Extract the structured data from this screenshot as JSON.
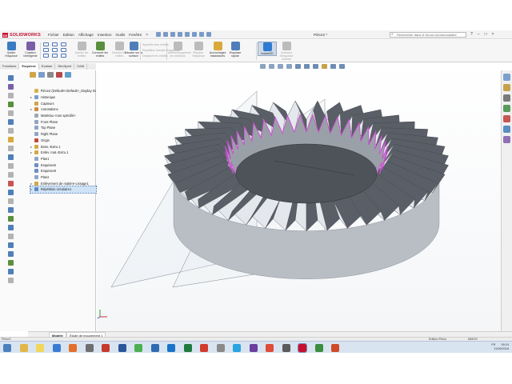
{
  "app": {
    "brand": "SOLIDWORKS",
    "document_title": "Pièce2 *",
    "menu": [
      "Fichier",
      "Edition",
      "Affichage",
      "Insertion",
      "Outils",
      "Fenêtre",
      "?"
    ],
    "search_placeholder": "Rechercher dans le forum communautaire",
    "window_controls": [
      "?",
      "–",
      "□",
      "×"
    ]
  },
  "command_manager": {
    "buttons": [
      {
        "id": "exit-sketch",
        "label": "Quitter l'esquisse",
        "color": "#3a7cc4",
        "enabled": true
      },
      {
        "id": "smart-dimension",
        "label": "Cotation intelligente",
        "color": "#7a5fa8",
        "enabled": true
      },
      {
        "id": "trim-entities",
        "label": "Ajuster les entités",
        "color": "#bcbcbc",
        "enabled": false
      },
      {
        "id": "convert-entities",
        "label": "Convertir les entités",
        "color": "#5a8f3c",
        "enabled": true
      },
      {
        "id": "offset-entities",
        "label": "Décaler les entités",
        "color": "#bcbcbc",
        "enabled": false
      },
      {
        "id": "offset-on-surface",
        "label": "Décaler sur la surface",
        "color": "#4f7fb8",
        "enabled": true
      },
      {
        "id": "display-relations",
        "label": "Afficher/supprimer les relations",
        "color": "#bcbcbc",
        "enabled": false
      },
      {
        "id": "repair-sketch",
        "label": "Réparer l'esquisse",
        "color": "#bcbcbc",
        "enabled": false
      },
      {
        "id": "quick-snaps",
        "label": "Accrochages instantanés",
        "color": "#d9a93c",
        "enabled": true
      },
      {
        "id": "rapid-sketch",
        "label": "Esquisse rapide",
        "color": "#4f7fb8",
        "enabled": true
      },
      {
        "id": "instant2d",
        "label": "Instant2D",
        "color": "#2f7bd1",
        "enabled": true
      },
      {
        "id": "shaded-sketch",
        "label": "Contours d'esquisse ombrés",
        "color": "#bcbcbc",
        "enabled": false
      }
    ],
    "secondary_labels": [
      "Symétrie des entités",
      "Répétition linéaire d'esquisse",
      "Déplacer les entités"
    ]
  },
  "tabs": [
    "Fonctions",
    "Esquisse",
    "Evaluer",
    "DimXpert",
    "CAM"
  ],
  "active_tab": "Esquisse",
  "feature_tree": [
    {
      "label": "Pièce2 (Default<<Default>_Display Stat",
      "icon": "part-icon",
      "color": "#d8b24a",
      "expand": "",
      "selected": false
    },
    {
      "label": "Historique",
      "icon": "history-icon",
      "color": "#7b9ec9",
      "expand": "▸",
      "selected": false
    },
    {
      "label": "Capteurs",
      "icon": "sensor-icon",
      "color": "#d0a64d",
      "expand": "",
      "selected": false
    },
    {
      "label": "Annotations",
      "icon": "annotation-icon",
      "color": "#d18a3c",
      "expand": "▸",
      "selected": false
    },
    {
      "label": "Matériau <non spécifié>",
      "icon": "material-icon",
      "color": "#9fa9b5",
      "expand": "",
      "selected": false
    },
    {
      "label": "Front Plane",
      "icon": "plane-icon",
      "color": "#8fa6c3",
      "expand": "",
      "selected": false
    },
    {
      "label": "Top Plane",
      "icon": "plane-icon",
      "color": "#8fa6c3",
      "expand": "",
      "selected": false
    },
    {
      "label": "Right Plane",
      "icon": "plane-icon",
      "color": "#8fa6c3",
      "expand": "",
      "selected": false
    },
    {
      "label": "Origin",
      "icon": "origin-icon",
      "color": "#c14a3a",
      "expand": "",
      "selected": false
    },
    {
      "label": "Boss.-Extru.1",
      "icon": "extrude-icon",
      "color": "#d2a94a",
      "expand": "▸",
      "selected": false
    },
    {
      "label": "Enlèv. mat.-Extru.1",
      "icon": "cut-icon",
      "color": "#d2a94a",
      "expand": "▸",
      "selected": false
    },
    {
      "label": "Plan1",
      "icon": "plane-icon",
      "color": "#8fa6c3",
      "expand": "",
      "selected": false
    },
    {
      "label": "Esquisse5",
      "icon": "sketch-icon",
      "color": "#6b8fbf",
      "expand": "",
      "selected": false
    },
    {
      "label": "Esquisse8",
      "icon": "sketch-icon",
      "color": "#6b8fbf",
      "expand": "",
      "selected": false
    },
    {
      "label": "Plan2",
      "icon": "plane-icon",
      "color": "#8fa6c3",
      "expand": "",
      "selected": false
    },
    {
      "label": "Enlèvement de matière-Lissage1",
      "icon": "loft-cut-icon",
      "color": "#d2a94a",
      "expand": "▸",
      "selected": false
    },
    {
      "label": "Répétition circulaire1",
      "icon": "circular-pattern-icon",
      "color": "#5d8bc4",
      "expand": "▸",
      "selected": true
    }
  ],
  "bottom_tabs": [
    "Modèle",
    "Etude de mouvement 1"
  ],
  "active_bottom_tab": "Modèle",
  "status_bar": {
    "left": "Pièce2",
    "mode": "Edition Pièce",
    "units": "MMGS"
  },
  "taskbar": {
    "apps": [
      {
        "name": "start-icon",
        "color": "#4d7fbf"
      },
      {
        "name": "explorer-icon",
        "color": "#e2b645"
      },
      {
        "name": "sticky-notes-icon",
        "color": "#f1d65a"
      },
      {
        "name": "browser-icon",
        "color": "#3a7cd4"
      },
      {
        "name": "media-player-icon",
        "color": "#e36f2b"
      },
      {
        "name": "calculator-icon",
        "color": "#6f6f6f"
      },
      {
        "name": "filezilla-icon",
        "color": "#c73a2e"
      },
      {
        "name": "word-icon",
        "color": "#2b5797"
      },
      {
        "name": "chrome-icon",
        "color": "#4caf50"
      },
      {
        "name": "settings-icon",
        "color": "#2f6bb0"
      },
      {
        "name": "teamviewer-icon",
        "color": "#1a73c9"
      },
      {
        "name": "excel-icon",
        "color": "#1f7a3f"
      },
      {
        "name": "opera-icon",
        "color": "#d23a2e"
      },
      {
        "name": "app-icon",
        "color": "#8a8a8a"
      },
      {
        "name": "skype-icon",
        "color": "#2aa3df"
      },
      {
        "name": "visual-studio-icon",
        "color": "#6a3fa0"
      },
      {
        "name": "chrome-alt-icon",
        "color": "#e04b3a"
      },
      {
        "name": "gallery-icon",
        "color": "#5a5a5a"
      },
      {
        "name": "solidworks-icon",
        "color": "#c8102e"
      },
      {
        "name": "chrome-2-icon",
        "color": "#3b8d3f"
      },
      {
        "name": "office-icon",
        "color": "#d04a2a"
      }
    ],
    "language": "FR",
    "time": "09:24",
    "date": "11/06/2018"
  },
  "model": {
    "body_color": "#b9bec5",
    "tooth_light": "#e4e7ec",
    "tooth_dark": "#5a5f67",
    "edge_highlight": "#d04ad8",
    "tooth_count": 40
  }
}
